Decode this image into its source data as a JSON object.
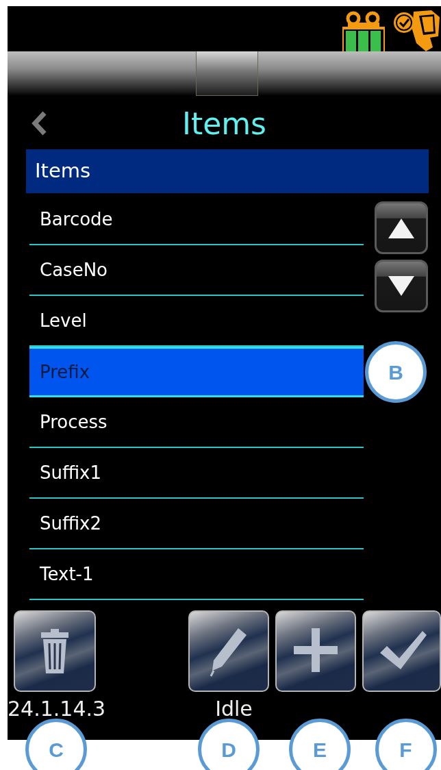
{
  "title": "Items",
  "list": {
    "header": "Items",
    "callout": "B",
    "items": [
      {
        "label": "Barcode",
        "selected": false
      },
      {
        "label": "CaseNo",
        "selected": false
      },
      {
        "label": "Level",
        "selected": false
      },
      {
        "label": "Prefix",
        "selected": true
      },
      {
        "label": "Process",
        "selected": false
      },
      {
        "label": "Suffix1",
        "selected": false
      },
      {
        "label": "Suffix2",
        "selected": false
      },
      {
        "label": "Text-1",
        "selected": false
      }
    ]
  },
  "buttons": [
    {
      "kind": "delete",
      "callout": "C"
    },
    {
      "kind": "edit",
      "callout": "D"
    },
    {
      "kind": "add",
      "callout": "E"
    },
    {
      "kind": "confirm",
      "callout": "F"
    }
  ],
  "version": "24.1.14.3",
  "status": "Idle"
}
